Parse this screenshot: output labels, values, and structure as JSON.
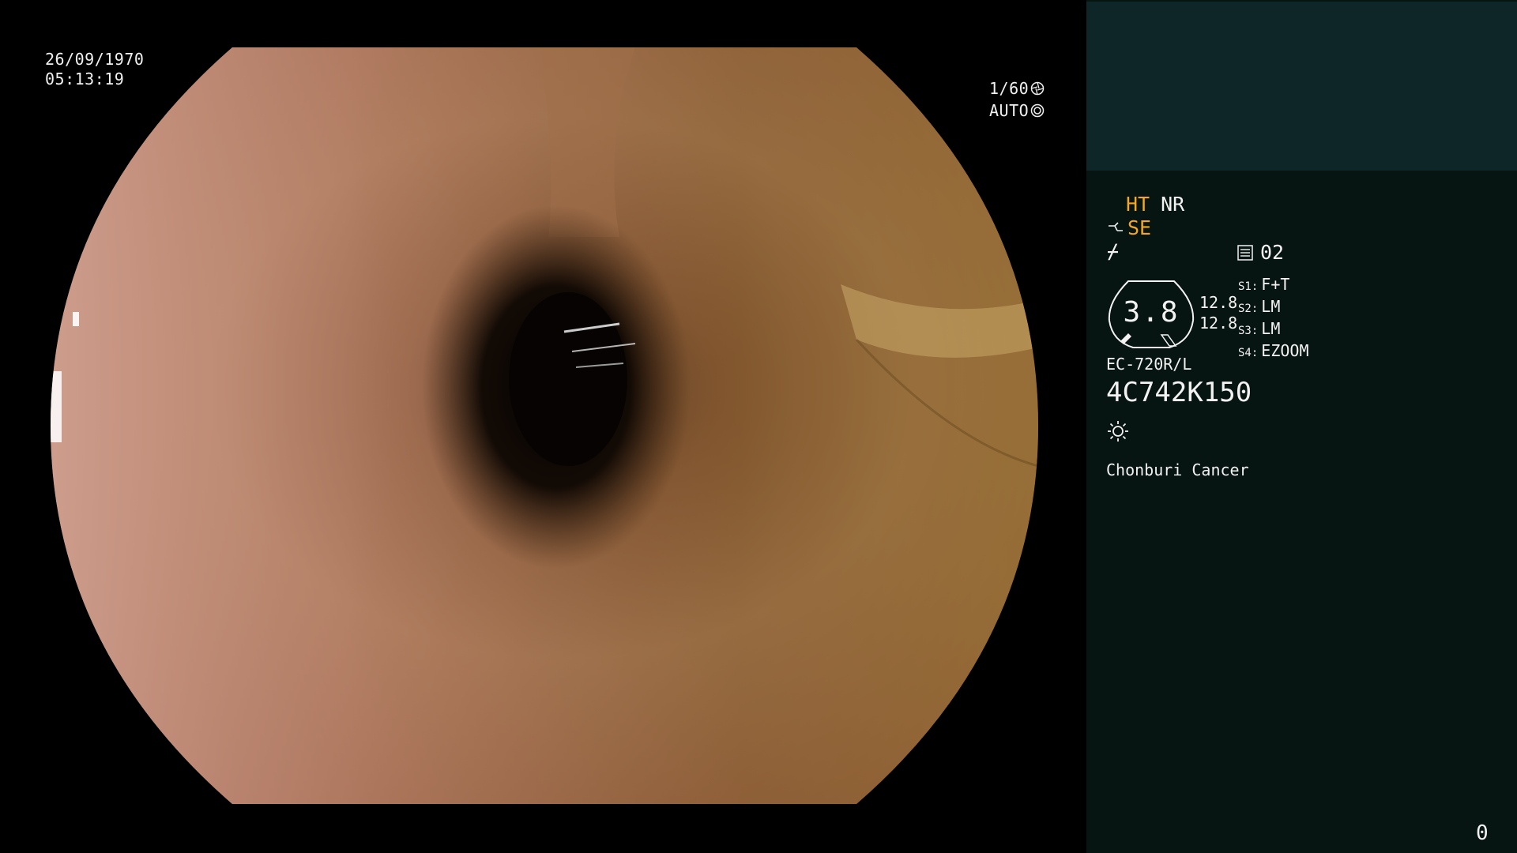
{
  "overlay": {
    "date": "26/09/1970",
    "time": "05:13:19",
    "shutter": "1/60",
    "iris_mode": "AUTO"
  },
  "panel": {
    "mode_ht": "HT",
    "mode_nr": "NR",
    "se_label": "SE",
    "emphasis_symbol": "⌿",
    "page_number": "02",
    "zoom_value": "3.8",
    "level_1": "12.8",
    "level_2": "12.8",
    "switches": [
      {
        "key": "S1:",
        "value": "F+T"
      },
      {
        "key": "S2:",
        "value": "LM"
      },
      {
        "key": "S3:",
        "value": "LM"
      },
      {
        "key": "S4:",
        "value": "EZOOM"
      }
    ],
    "scope_model": "EC-720R/L",
    "serial": "4C742K150",
    "hospital": "Chonburi Cancer",
    "frame_counter": "0"
  },
  "colors": {
    "accent_orange": "#f5a623",
    "panel_bg": "#071512",
    "thumb_bg": "#0e2628"
  },
  "icons": [
    "shutter-icon",
    "iris-icon",
    "scope-tip-icon",
    "page-icon",
    "light-icon"
  ]
}
